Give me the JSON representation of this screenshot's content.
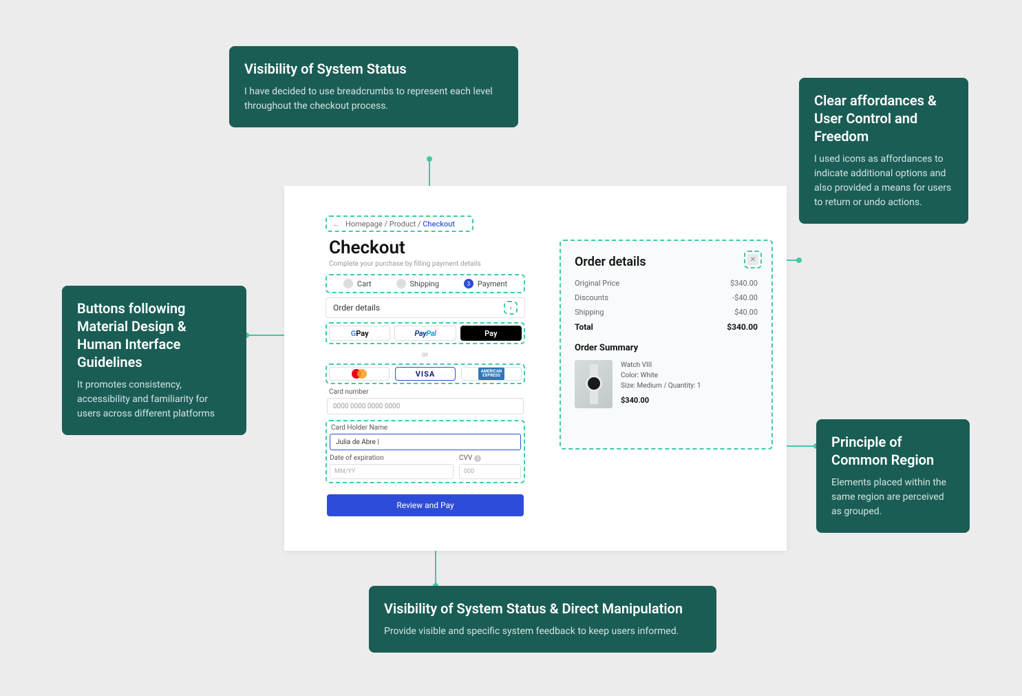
{
  "callouts": {
    "top": {
      "title": "Visibility of System Status",
      "body": "I have decided to use breadcrumbs to represent each level throughout the checkout process."
    },
    "left": {
      "title": "Buttons following Material Design & Human Interface Guidelines",
      "body": "It promotes consistency, accessibility and familiarity for users across different platforms"
    },
    "right_top": {
      "title": "Clear affordances & User Control and Freedom",
      "body": "I used icons as affordances to indicate additional options and also provided a means for users to return or undo actions."
    },
    "right_bottom": {
      "title": "Principle of Common Region",
      "body": "Elements placed within the same region are perceived as grouped."
    },
    "bottom": {
      "title": "Visibility of System Status & Direct Manipulation",
      "body": "Provide visible and specific system feedback to keep users informed."
    }
  },
  "breadcrumb": {
    "back": "←",
    "path1": "Homepage",
    "path2": "Product",
    "current": "Checkout"
  },
  "checkout": {
    "title": "Checkout",
    "subtitle": "Complete your purchase by filling payment details"
  },
  "steps": {
    "s1": "Cart",
    "s2": "Shipping",
    "s3_num": "3",
    "s3": "Payment"
  },
  "order_row": {
    "label": "Order details"
  },
  "payoptions": {
    "gpay_suffix": " Pay",
    "paypal_pay": "Pay",
    "paypal_pal": "Pal",
    "applepay": " Pay"
  },
  "or_text": "or",
  "cards": {
    "visa": "VISA",
    "amex_l1": "AMERICAN",
    "amex_l2": "EXPRESS"
  },
  "form": {
    "cardnum_label": "Card number",
    "cardnum_ph": "0000 0000 0000 0000",
    "holder_label": "Card Holder Name",
    "holder_value": "Julia de Abre |",
    "date_label": "Date of expiration",
    "date_ph": "MM/YY",
    "cvv_label": "CVV",
    "cvv_ph": "000",
    "review_btn": "Review and Pay"
  },
  "panel": {
    "title": "Order details",
    "rows": {
      "orig_l": "Original Price",
      "orig_v": "$340.00",
      "disc_l": "Discounts",
      "disc_v": "-$40.00",
      "ship_l": "Shipping",
      "ship_v": "$40.00",
      "total_l": "Total",
      "total_v": "$340.00"
    },
    "summary_title": "Order Summary",
    "item": {
      "name": "Watch VIII",
      "color": "Color: White",
      "size": "Size: Medium / Quantity: 1",
      "price": "$340.00"
    }
  }
}
